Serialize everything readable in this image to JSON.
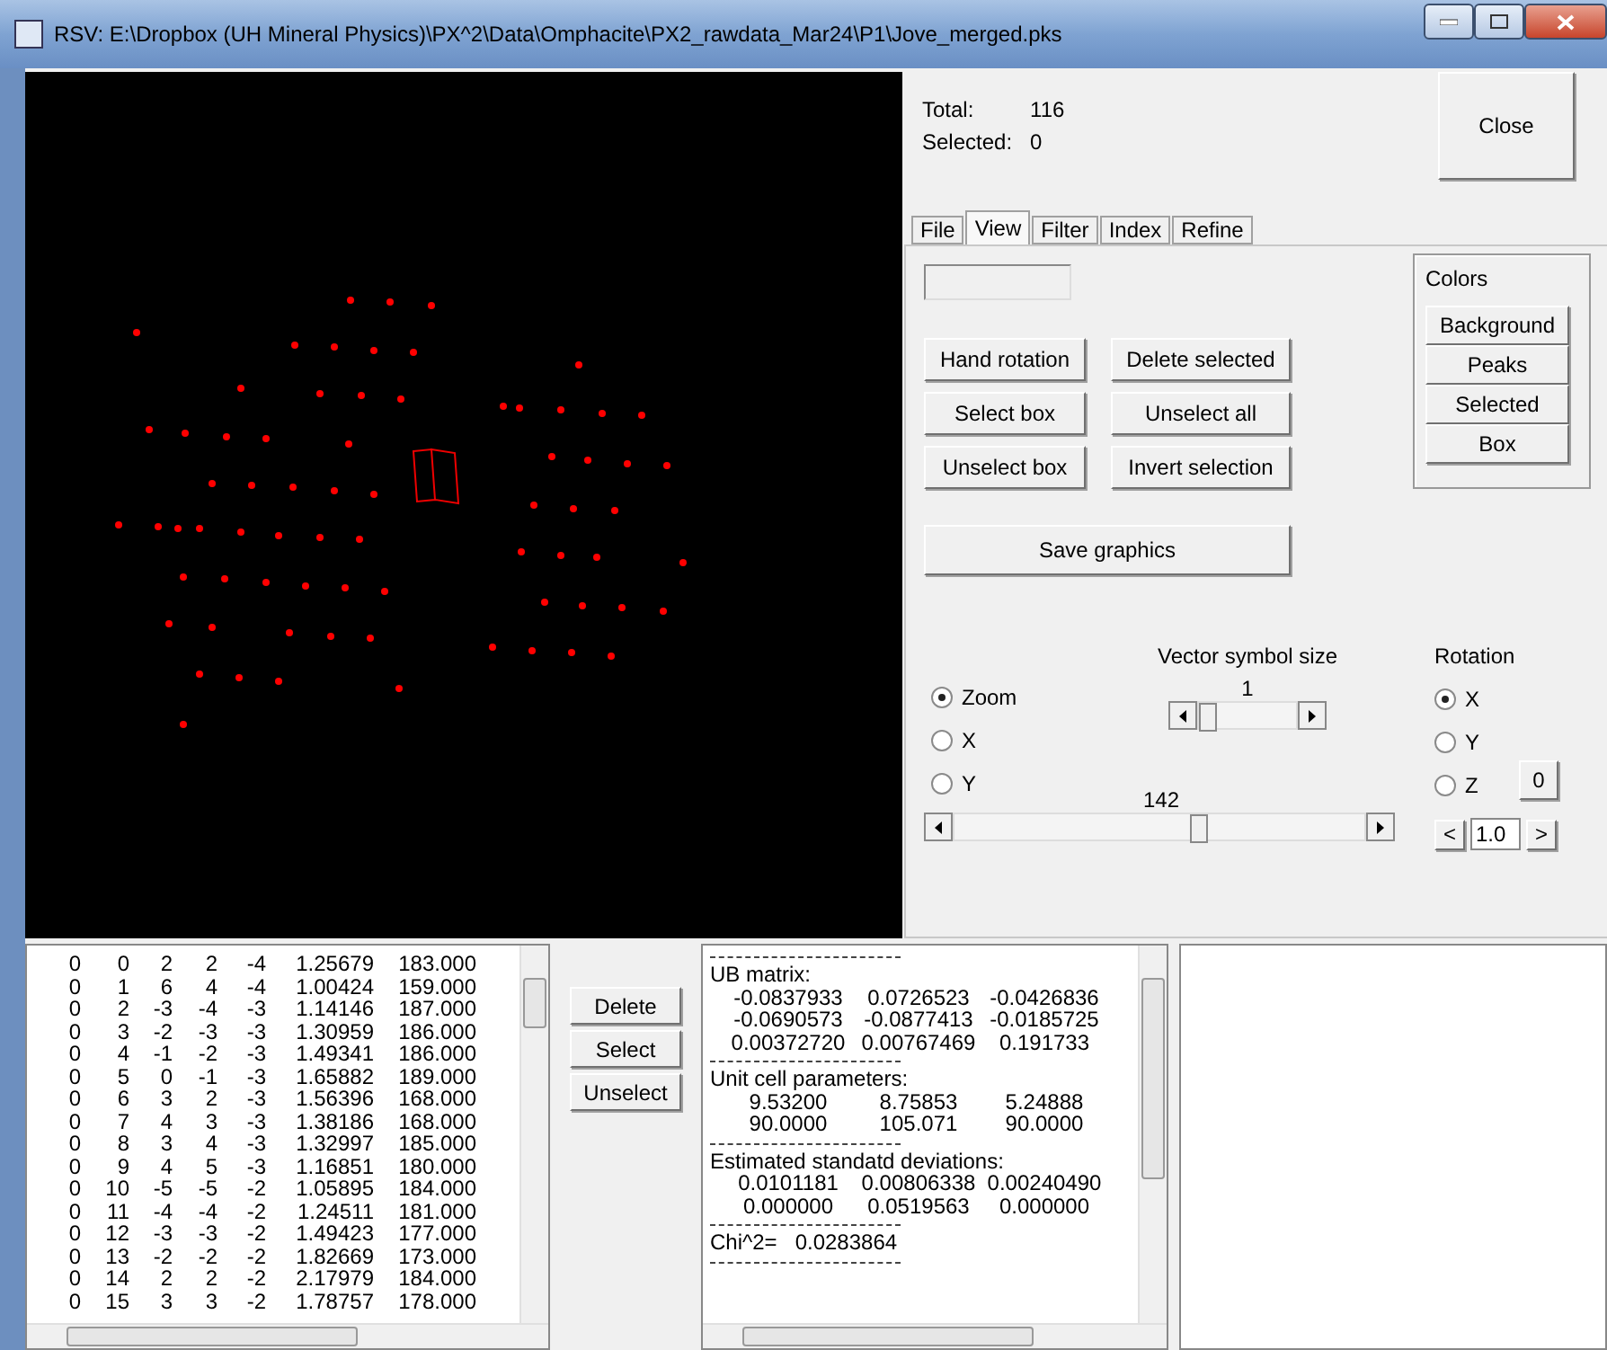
{
  "window": {
    "title": "RSV: E:\\Dropbox (UH Mineral Physics)\\PX^2\\Data\\Omphacite\\PX2_rawdata_Mar24\\P1\\Jove_merged.pks"
  },
  "summary": [
    {
      "label": "Total:",
      "value": "116"
    },
    {
      "label": "Selected:",
      "value": "0"
    }
  ],
  "close_button": "Close",
  "tabs": [
    {
      "label": "File",
      "selected": false
    },
    {
      "label": "View",
      "selected": true
    },
    {
      "label": "Filter",
      "selected": false
    },
    {
      "label": "Index",
      "selected": false
    },
    {
      "label": "Refine",
      "selected": false
    }
  ],
  "view_buttons": [
    "Hand rotation",
    "Delete selected",
    "Select box",
    "Unselect all",
    "Unselect box",
    "Invert selection"
  ],
  "colors": {
    "title": "Colors",
    "buttons": [
      "Background",
      "Peaks",
      "Selected",
      "Box"
    ]
  },
  "save_button": "Save graphics",
  "view_mode": [
    {
      "label": "Zoom",
      "selected": true
    },
    {
      "label": "X",
      "selected": false
    },
    {
      "label": "Y",
      "selected": false
    }
  ],
  "vector_size": {
    "label": "Vector symbol size",
    "reading": "1",
    "level": 0
  },
  "zoom_slider": {
    "reading": "142",
    "level": 0.6
  },
  "rotation": {
    "title": "Rotation",
    "axes": [
      {
        "label": "X",
        "selected": true
      },
      {
        "label": "Y",
        "selected": false
      },
      {
        "label": "Z",
        "selected": false
      }
    ],
    "reset_button": "0",
    "prev_button": "<",
    "step": "1.0",
    "next_button": ">"
  },
  "peaks_table": {
    "rows": [
      [
        "0",
        "0",
        "2",
        "2",
        "-4",
        "1.25679",
        "183.000"
      ],
      [
        "0",
        "1",
        "6",
        "4",
        "-4",
        "1.00424",
        "159.000"
      ],
      [
        "0",
        "2",
        "-3",
        "-4",
        "-3",
        "1.14146",
        "187.000"
      ],
      [
        "0",
        "3",
        "-2",
        "-3",
        "-3",
        "1.30959",
        "186.000"
      ],
      [
        "0",
        "4",
        "-1",
        "-2",
        "-3",
        "1.49341",
        "186.000"
      ],
      [
        "0",
        "5",
        "0",
        "-1",
        "-3",
        "1.65882",
        "189.000"
      ],
      [
        "0",
        "6",
        "3",
        "2",
        "-3",
        "1.56396",
        "168.000"
      ],
      [
        "0",
        "7",
        "4",
        "3",
        "-3",
        "1.38186",
        "168.000"
      ],
      [
        "0",
        "8",
        "3",
        "4",
        "-3",
        "1.32997",
        "185.000"
      ],
      [
        "0",
        "9",
        "4",
        "5",
        "-3",
        "1.16851",
        "180.000"
      ],
      [
        "0",
        "10",
        "-5",
        "-5",
        "-2",
        "1.05895",
        "184.000"
      ],
      [
        "0",
        "11",
        "-4",
        "-4",
        "-2",
        "1.24511",
        "181.000"
      ],
      [
        "0",
        "12",
        "-3",
        "-3",
        "-2",
        "1.49423",
        "177.000"
      ],
      [
        "0",
        "13",
        "-2",
        "-2",
        "-2",
        "1.82669",
        "173.000"
      ],
      [
        "0",
        "14",
        "2",
        "2",
        "-2",
        "2.17979",
        "184.000"
      ],
      [
        "0",
        "15",
        "3",
        "3",
        "-2",
        "1.78757",
        "178.000"
      ]
    ]
  },
  "list_buttons": [
    "Delete",
    "Select",
    "Unselect"
  ],
  "results": [
    {
      "kind": "rule"
    },
    {
      "kind": "heading",
      "text": "UB matrix:"
    },
    {
      "kind": "values",
      "values": [
        "-0.0837933",
        "0.0726523",
        "-0.0426836"
      ]
    },
    {
      "kind": "values",
      "values": [
        "-0.0690573",
        "-0.0877413",
        "-0.0185725"
      ]
    },
    {
      "kind": "values",
      "values": [
        "0.00372720",
        "0.00767469",
        "0.191733"
      ]
    },
    {
      "kind": "rule"
    },
    {
      "kind": "heading",
      "text": "Unit cell parameters:"
    },
    {
      "kind": "values",
      "values": [
        "9.53200",
        "8.75853",
        "5.24888"
      ]
    },
    {
      "kind": "values",
      "values": [
        "90.0000",
        "105.071",
        "90.0000"
      ]
    },
    {
      "kind": "rule"
    },
    {
      "kind": "heading",
      "text": "Estimated standatd deviations:"
    },
    {
      "kind": "values",
      "values": [
        "0.0101181",
        "0.00806338",
        "0.00240490"
      ]
    },
    {
      "kind": "values",
      "values": [
        "0.000000",
        "0.0519563",
        "0.000000"
      ]
    },
    {
      "kind": "rule"
    },
    {
      "kind": "heading",
      "text": "Chi^2=   0.0283864"
    },
    {
      "kind": "rule"
    }
  ]
}
